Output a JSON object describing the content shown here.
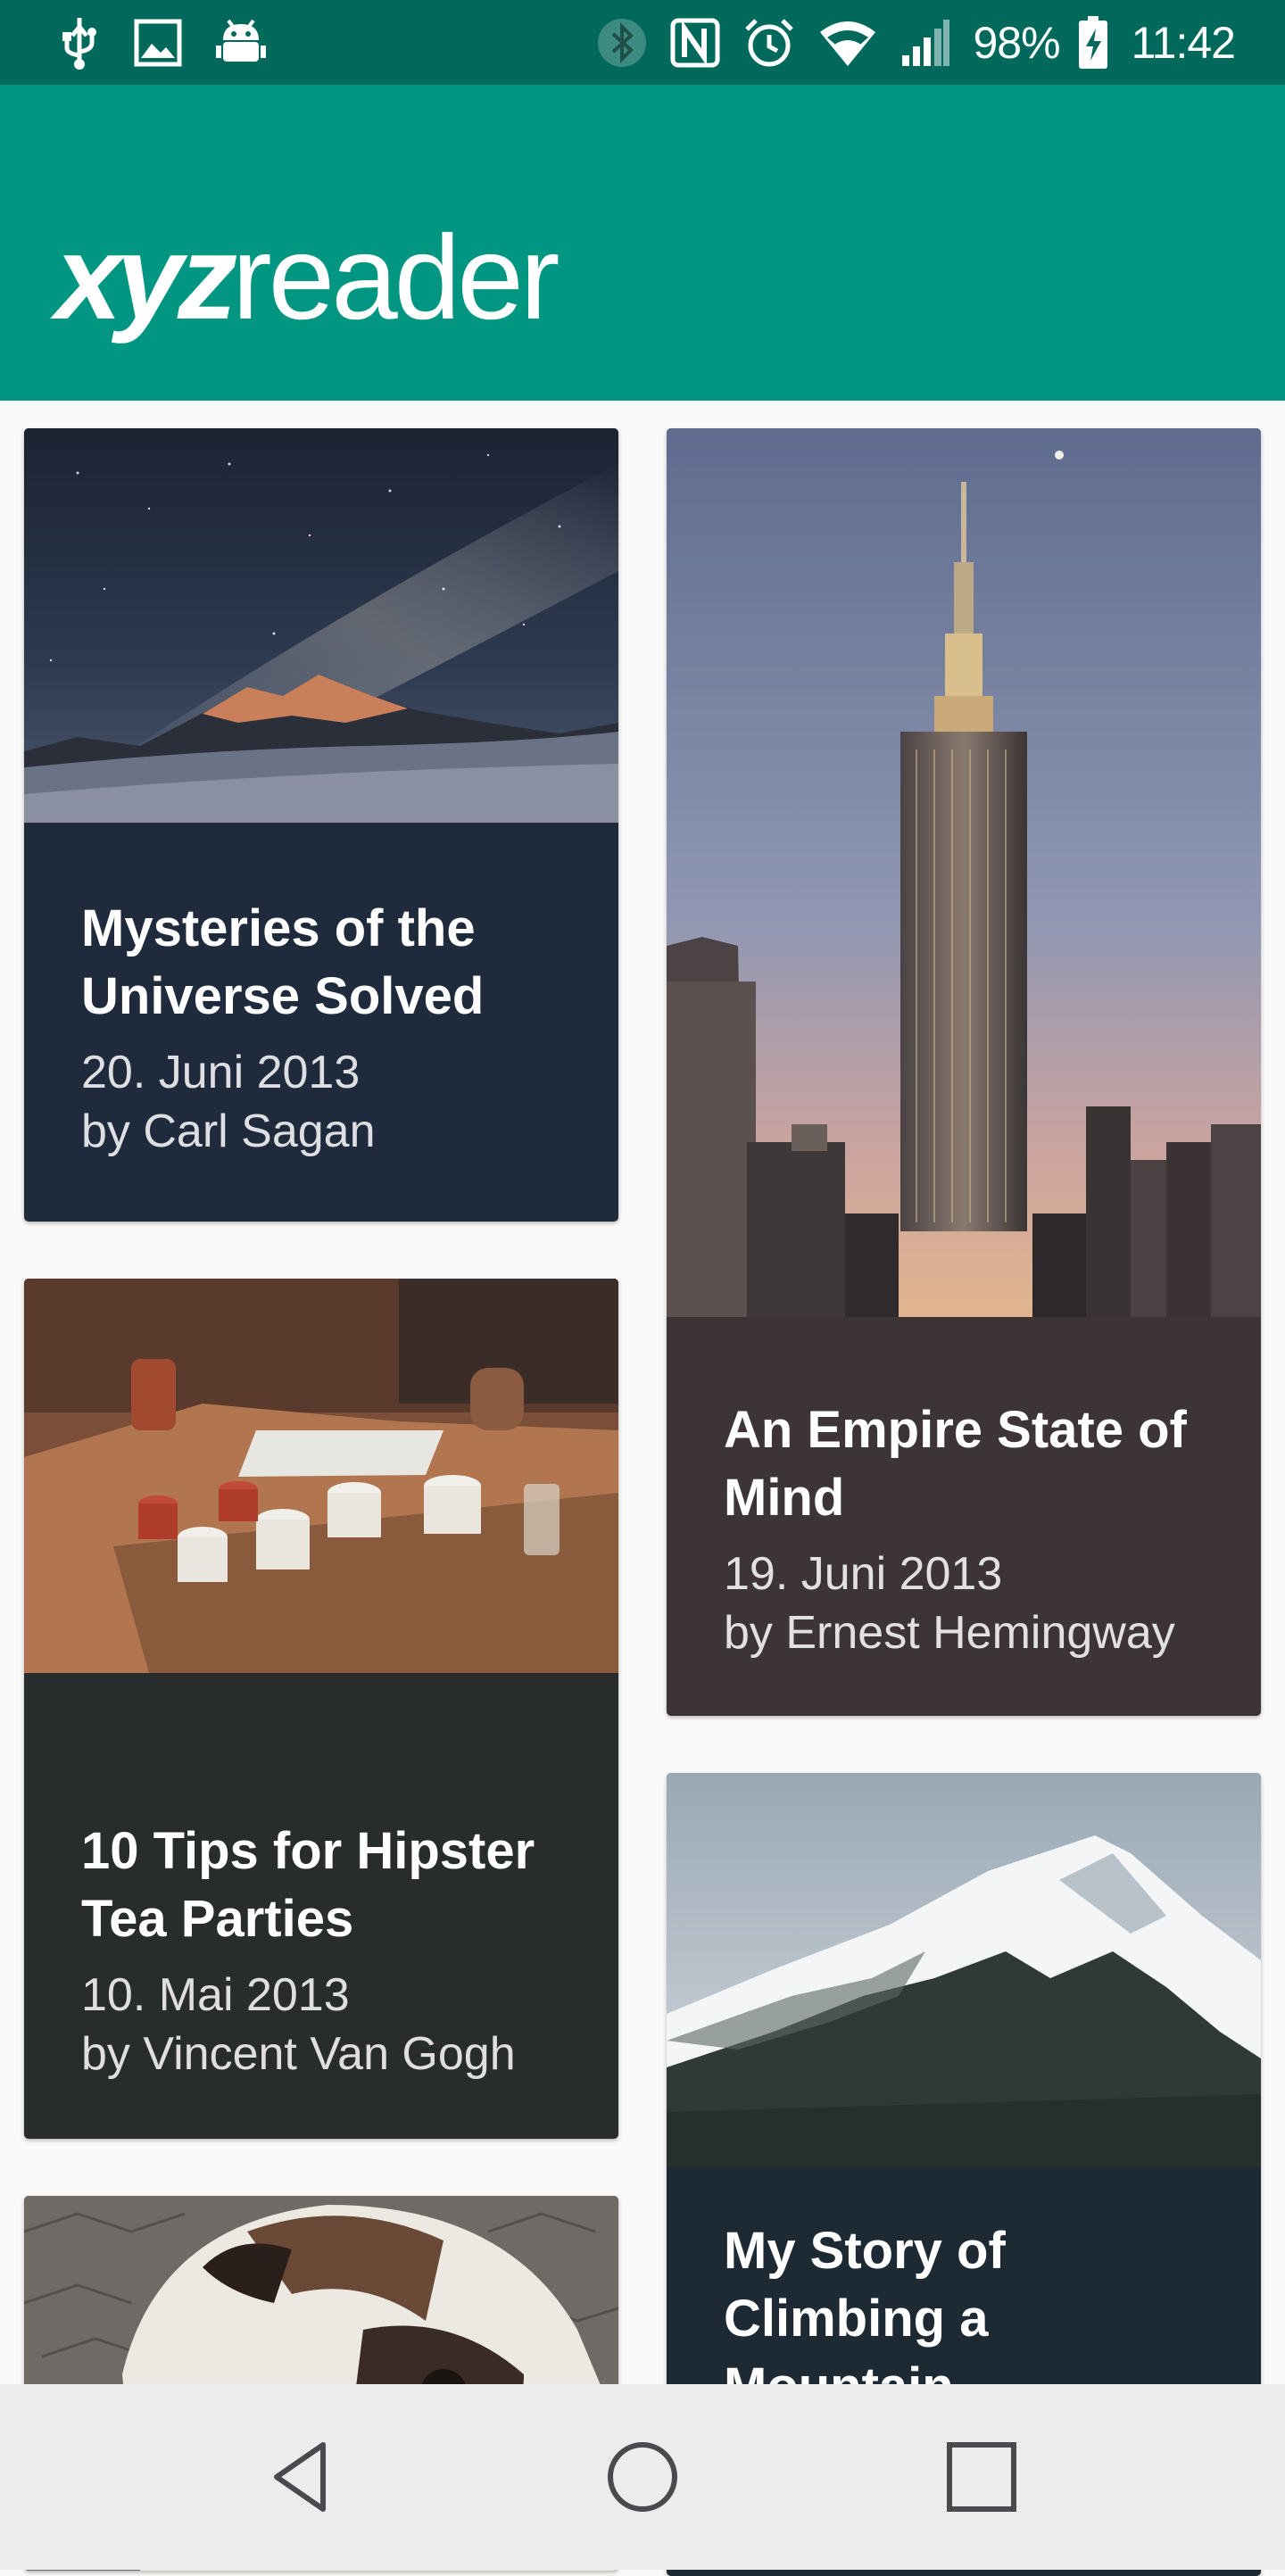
{
  "status_bar": {
    "left_icons": [
      "usb-icon",
      "image-icon",
      "android-debug-icon"
    ],
    "right_icons": [
      "bluetooth-icon",
      "nfc-icon",
      "alarm-icon",
      "wifi-icon",
      "signal-icon",
      "battery-charging-icon"
    ],
    "battery_percent": "98%",
    "time": "11:42"
  },
  "app_bar": {
    "logo_bold": "xyz",
    "logo_regular": "reader",
    "background_color": "#009682"
  },
  "articles": [
    {
      "title": "Mysteries of the Universe Solved",
      "date": "20. Juni 2013",
      "author": "by Carl Sagan",
      "image": "night-sky-mountain",
      "card_color": "#1f2b3c"
    },
    {
      "title": "An Empire State of Mind",
      "date": "19. Juni 2013",
      "author": "by Ernest Hemingway",
      "image": "empire-state-building",
      "card_color": "#3c3435"
    },
    {
      "title": "10 Tips for Hipster Tea Parties",
      "date": "10. Mai 2013",
      "author": "by Vincent Van Gogh",
      "image": "tea-cups-table",
      "card_color": "#282c2d"
    },
    {
      "title": "My Story of Climbing a Mountain",
      "date": "",
      "author": "",
      "image": "snowy-mountain",
      "card_color": "#1e2a33"
    },
    {
      "title": "",
      "date": "",
      "author": "",
      "image": "bulldog",
      "card_color": "#2b2b2b"
    }
  ],
  "nav_bar": {
    "buttons": [
      "back-icon",
      "home-icon",
      "recents-icon"
    ]
  }
}
